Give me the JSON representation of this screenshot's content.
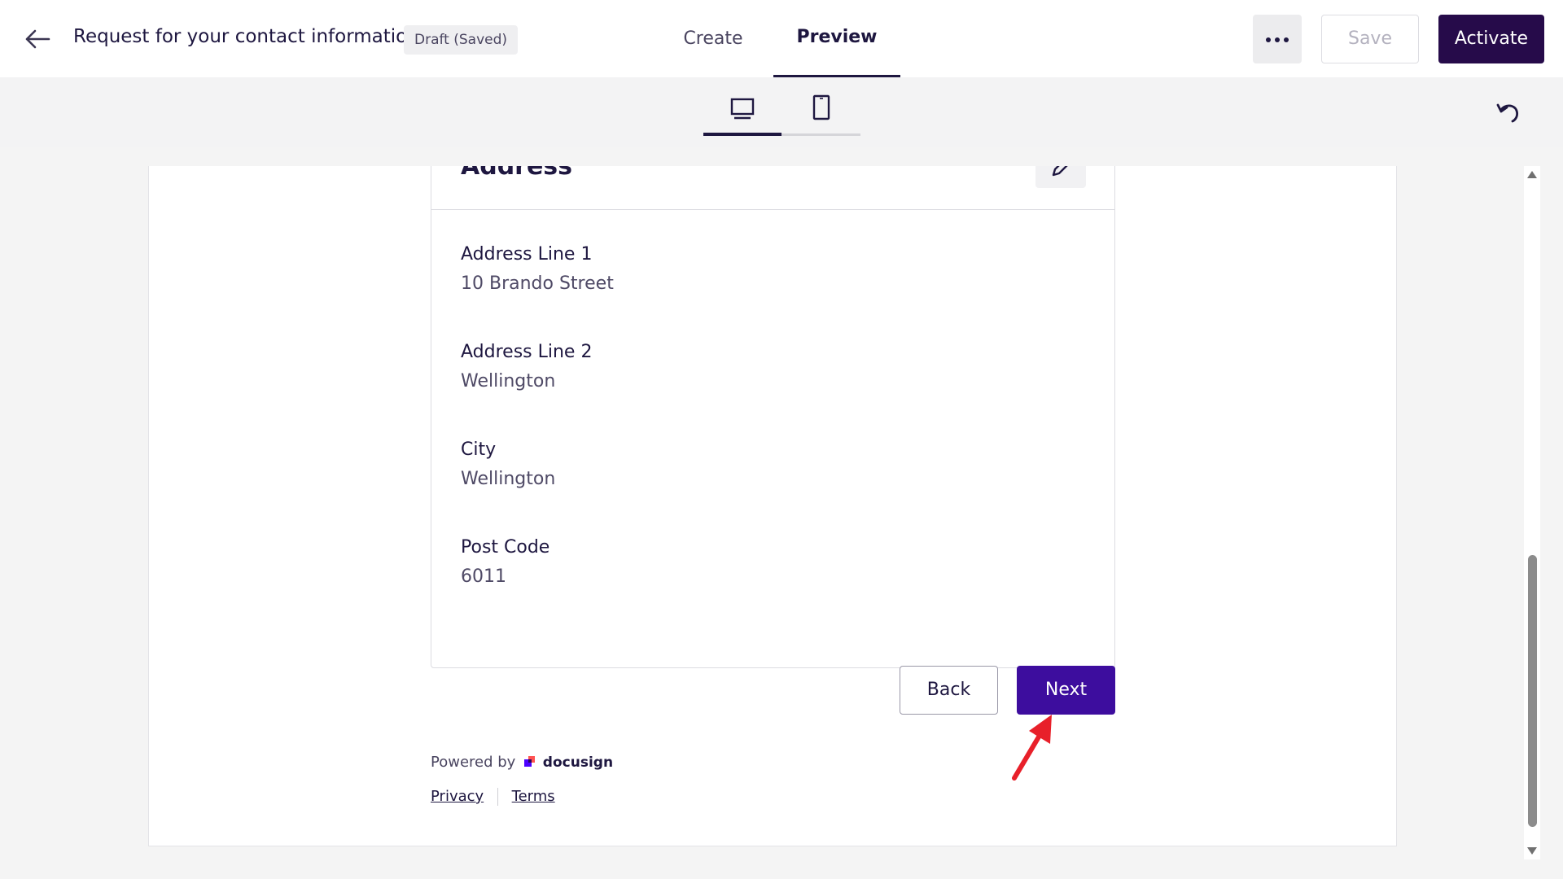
{
  "header": {
    "title": "Request for your contact information",
    "status_badge": "Draft (Saved)",
    "tabs": [
      {
        "label": "Create",
        "active": false
      },
      {
        "label": "Preview",
        "active": true
      }
    ],
    "save_label": "Save",
    "activate_label": "Activate"
  },
  "device_toolbar": {
    "selected": "desktop",
    "options": [
      "desktop-icon",
      "mobile-icon"
    ]
  },
  "form": {
    "section_title": "Address",
    "fields": [
      {
        "label": "Address Line 1",
        "value": "10 Brando Street"
      },
      {
        "label": "Address Line 2",
        "value": "Wellington"
      },
      {
        "label": "City",
        "value": "Wellington"
      },
      {
        "label": "Post Code",
        "value": "6011"
      }
    ],
    "back_label": "Back",
    "next_label": "Next"
  },
  "footer": {
    "powered_by": "Powered by",
    "brand": "docusign",
    "privacy": "Privacy",
    "terms": "Terms"
  },
  "colors": {
    "primary_dark": "#260b4a",
    "primary_button": "#3d0d9e",
    "annotation_arrow": "#e8202a",
    "text": "#1e1740"
  }
}
